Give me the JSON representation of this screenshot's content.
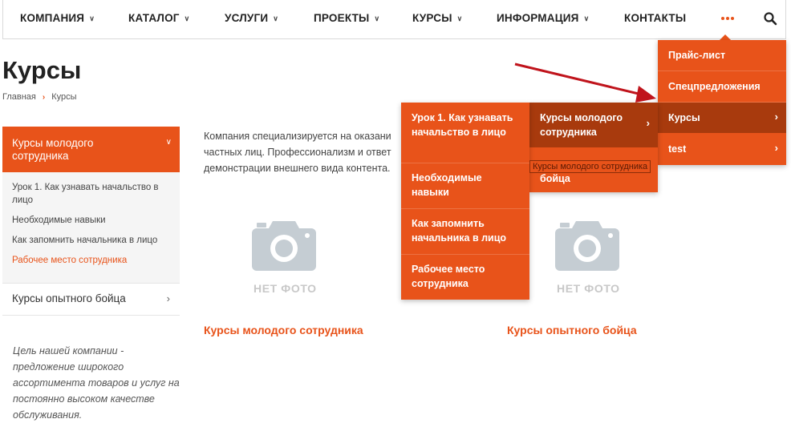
{
  "nav": {
    "items": [
      {
        "label": "КОМПАНИЯ",
        "has_dropdown": true
      },
      {
        "label": "КАТАЛОГ",
        "has_dropdown": true
      },
      {
        "label": "УСЛУГИ",
        "has_dropdown": true
      },
      {
        "label": "ПРОЕКТЫ",
        "has_dropdown": true
      },
      {
        "label": "КУРСЫ",
        "has_dropdown": true
      },
      {
        "label": "ИНФОРМАЦИЯ",
        "has_dropdown": true
      },
      {
        "label": "КОНТАКТЫ",
        "has_dropdown": false
      }
    ],
    "more_icon": "more-dots-icon",
    "search_icon": "search-icon"
  },
  "page": {
    "title": "Курсы",
    "breadcrumb": [
      "Главная",
      "Курсы"
    ]
  },
  "sidebar": {
    "active_section": "Курсы молодого сотрудника",
    "sub_items": [
      {
        "label": "Урок 1. Как узнавать начальство в лицо",
        "active": false
      },
      {
        "label": "Необходимые навыки",
        "active": false
      },
      {
        "label": "Как запомнить начальника в лицо",
        "active": false
      },
      {
        "label": "Рабочее место сотрудника",
        "active": true
      }
    ],
    "second_section": "Курсы опытного бойца",
    "quote": "Цель нашей компании - предложение широкого ассортимента товаров и услуг на постоянно высоком качестве обслуживания."
  },
  "content": {
    "intro_lines": [
      "Компания специализируется на оказани",
      "частных лиц. Профессионализм и ответ",
      "демонстрации внешнего вида контента."
    ],
    "no_photo_label": "НЕТ ФОТО",
    "cards": [
      {
        "title": "Курсы молодого сотрудника"
      },
      {
        "title": "Курсы опытного бойца"
      }
    ]
  },
  "menu_more": {
    "items": [
      {
        "label": "Прайс-лист",
        "has_sub": false
      },
      {
        "label": "Спецпредложения",
        "has_sub": false
      },
      {
        "label": "Курсы",
        "has_sub": true,
        "highlighted": true
      },
      {
        "label": "test",
        "has_sub": true
      }
    ]
  },
  "menu_courses": {
    "items": [
      {
        "label": "Курсы молодого сотрудника",
        "has_sub": true,
        "highlighted": true
      },
      {
        "label": "Курсы опытного бойца",
        "has_sub": true
      }
    ]
  },
  "menu_lessons": {
    "items": [
      {
        "label": "Урок 1. Как узнавать начальство в лицо"
      },
      {
        "label": "Необходимые навыки"
      },
      {
        "label": "Как запомнить начальника в лицо"
      },
      {
        "label": "Рабочее место сотрудника"
      }
    ]
  },
  "tooltip": "Курсы молодого сотрудника",
  "colors": {
    "accent": "#e8531a",
    "highlight": "#a83a0d",
    "arrow": "#c0141c",
    "camera": "#c5cdd3"
  }
}
